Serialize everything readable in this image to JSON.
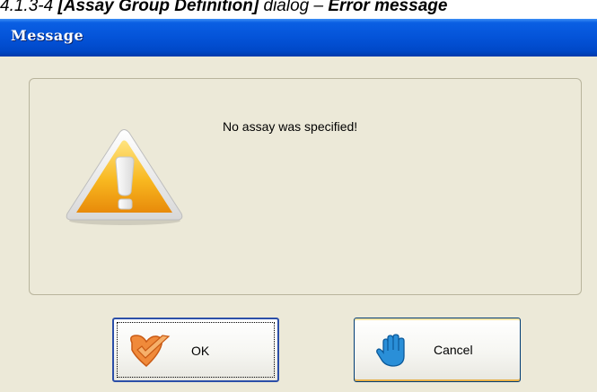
{
  "caption": {
    "prefix": "4.1.3-4 ",
    "bracket_title": "[Assay Group Definition]",
    "middle": " dialog – ",
    "tail": "Error message"
  },
  "window": {
    "title": "Message"
  },
  "dialog": {
    "message": "No assay was specified!",
    "icon": "warning-triangle-icon"
  },
  "buttons": {
    "ok_label": "OK",
    "ok_icon": "checkmark-heart-icon",
    "cancel_label": "Cancel",
    "cancel_icon": "stop-hand-icon"
  },
  "colors": {
    "titlebar": "#0453d8",
    "dialog_bg": "#ece9d8",
    "ok_border": "#2c4fa8",
    "warning_fill": "#f5b41e"
  }
}
